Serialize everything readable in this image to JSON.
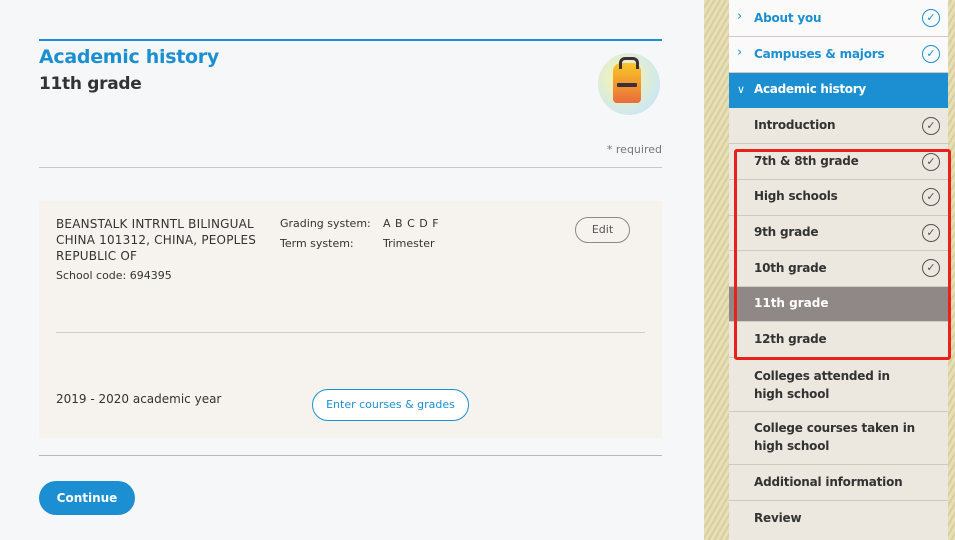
{
  "page": {
    "title": "Academic history",
    "subtitle": "11th grade",
    "required_note": "* required"
  },
  "school": {
    "name": "BEANSTALK INTRNTL BILINGUAL CHINA 101312, CHINA, PEOPLES REPUBLIC OF",
    "code": "School code: 694395",
    "grading_label": "Grading system:",
    "grading_value": "A B C D F",
    "term_label": "Term system:",
    "term_value": "Trimester",
    "edit_label": "Edit",
    "year_label": "2019 - 2020 academic year",
    "courses_label": "Enter courses & grades"
  },
  "continue_label": "Continue",
  "sidebar": {
    "items": [
      {
        "label": "About you",
        "status": "complete"
      },
      {
        "label": "Campuses & majors",
        "status": "complete"
      },
      {
        "label": "Academic history",
        "status": "expanded"
      },
      {
        "label": "Introduction",
        "status": "complete"
      },
      {
        "label": "7th & 8th grade",
        "status": "complete"
      },
      {
        "label": "High schools",
        "status": "complete"
      },
      {
        "label": "9th grade",
        "status": "complete"
      },
      {
        "label": "10th grade",
        "status": "complete"
      },
      {
        "label": "11th grade",
        "status": "current"
      },
      {
        "label": "12th grade",
        "status": "incomplete"
      },
      {
        "label": "Colleges attended in high school",
        "status": "incomplete"
      },
      {
        "label": "College courses taken in high school",
        "status": "incomplete"
      },
      {
        "label": "Additional information",
        "status": "incomplete"
      },
      {
        "label": "Review",
        "status": "incomplete"
      }
    ]
  },
  "icons": {
    "check": "check-circle-icon",
    "chevron_right": "chevron-right-icon",
    "chevron_down": "chevron-down-icon",
    "avatar": "backpack-icon"
  },
  "colors": {
    "accent": "#1b8fd1",
    "current_item": "#908887",
    "highlight": "#e8221a"
  }
}
